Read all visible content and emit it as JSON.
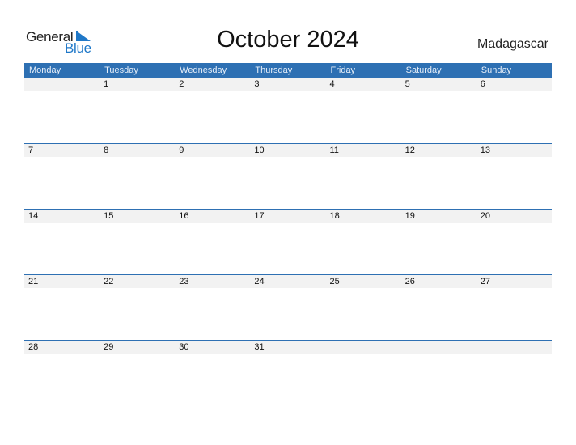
{
  "logo": {
    "word1": "General",
    "word2": "Blue"
  },
  "title": "October 2024",
  "country": "Madagascar",
  "accent_color": "#2e70b3",
  "weekdays": [
    "Monday",
    "Tuesday",
    "Wednesday",
    "Thursday",
    "Friday",
    "Saturday",
    "Sunday"
  ],
  "weeks": [
    [
      "",
      "1",
      "2",
      "3",
      "4",
      "5",
      "6"
    ],
    [
      "7",
      "8",
      "9",
      "10",
      "11",
      "12",
      "13"
    ],
    [
      "14",
      "15",
      "16",
      "17",
      "18",
      "19",
      "20"
    ],
    [
      "21",
      "22",
      "23",
      "24",
      "25",
      "26",
      "27"
    ],
    [
      "28",
      "29",
      "30",
      "31",
      "",
      "",
      ""
    ]
  ]
}
